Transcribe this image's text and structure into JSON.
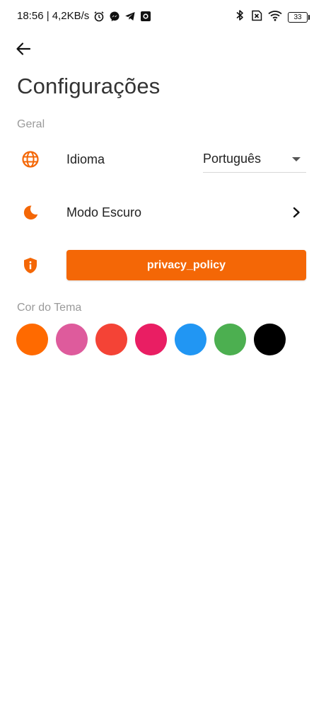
{
  "status_bar": {
    "time_and_speed": "18:56 | 4,2KB/s",
    "battery": "33",
    "icons": [
      "alarm-icon",
      "messenger-icon",
      "telegram-icon",
      "camera-icon",
      "bluetooth-icon",
      "no-sim-icon",
      "wifi-icon",
      "battery-icon"
    ]
  },
  "header": {
    "back_icon": "arrow-left-icon",
    "title": "Configurações"
  },
  "general": {
    "section_label": "Geral",
    "language": {
      "icon": "globe-icon",
      "label": "Idioma",
      "selected": "Português"
    },
    "dark_mode": {
      "icon": "moon-icon",
      "label": "Modo Escuro",
      "chevron_icon": "chevron-right-icon"
    },
    "privacy": {
      "icon": "shield-info-icon",
      "button_label": "privacy_policy"
    }
  },
  "theme": {
    "section_label": "Cor do Tema",
    "colors": [
      "#ff6a00",
      "#de5b9c",
      "#f44336",
      "#e91e63",
      "#2196f3",
      "#4caf50",
      "#000000"
    ]
  },
  "accent_color": "#f46706"
}
